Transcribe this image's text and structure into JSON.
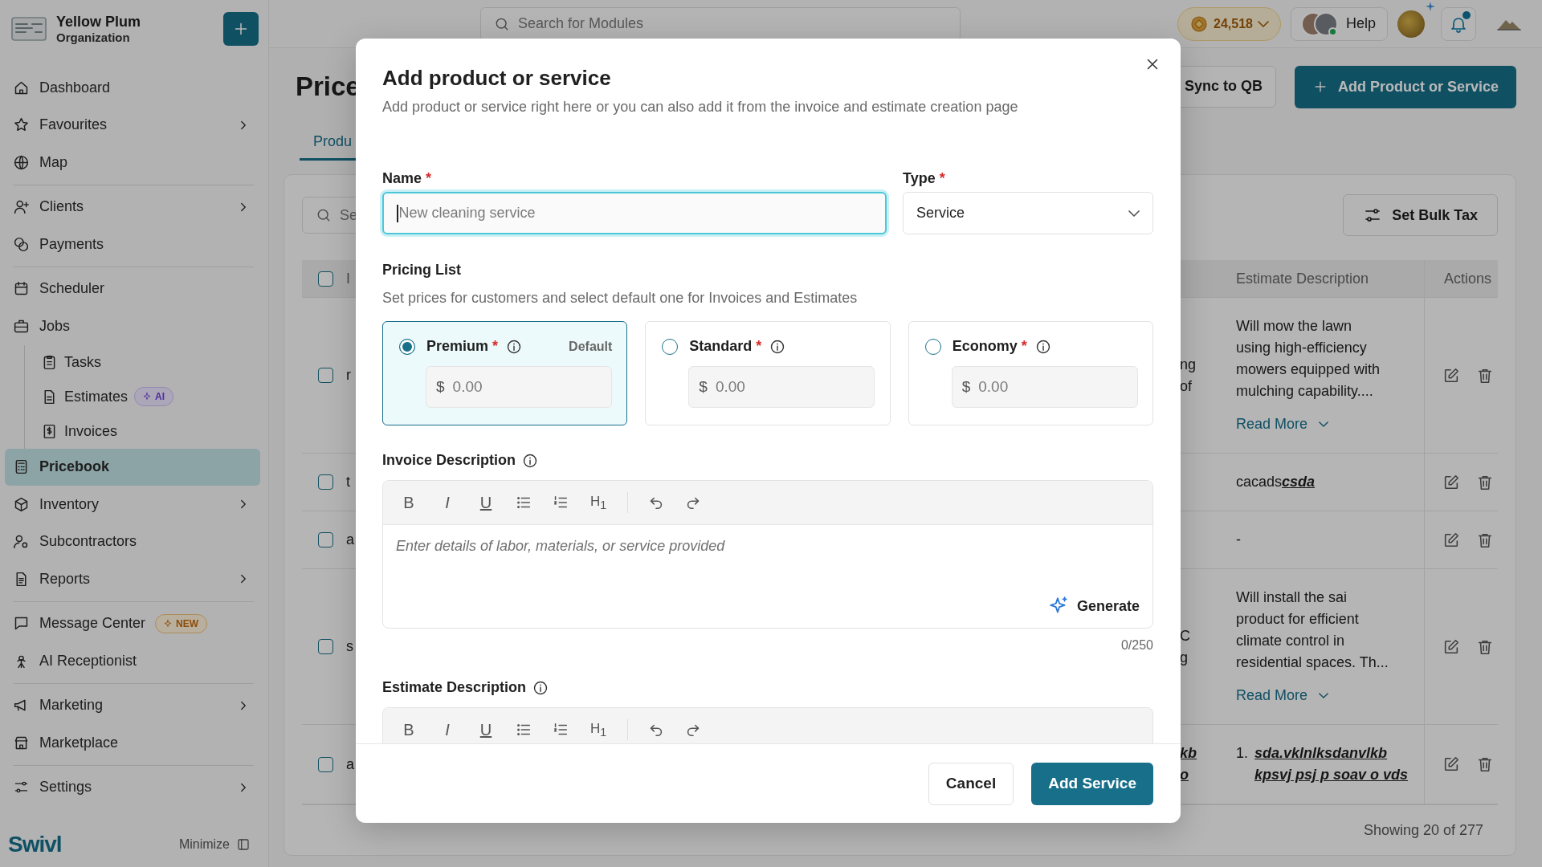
{
  "sidebar": {
    "org_name": "Yellow Plum",
    "org_subtitle": "Organization",
    "groups": [
      [
        {
          "label": "Dashboard",
          "selected": false,
          "has_submenu": false
        },
        {
          "label": "Favourites",
          "selected": false,
          "has_submenu": true
        },
        {
          "label": "Map",
          "selected": false,
          "has_submenu": false
        }
      ],
      [
        {
          "label": "Clients",
          "selected": false,
          "has_submenu": true
        },
        {
          "label": "Payments",
          "selected": false,
          "has_submenu": false
        }
      ],
      [
        {
          "label": "Scheduler",
          "selected": false,
          "has_submenu": false
        },
        {
          "label": "Jobs",
          "selected": false,
          "has_submenu": false,
          "children": [
            {
              "label": "Tasks",
              "selected": false
            },
            {
              "label": "Estimates",
              "selected": false,
              "badge": {
                "kind": "ai",
                "label": "AI"
              }
            },
            {
              "label": "Invoices",
              "selected": false
            }
          ]
        },
        {
          "label": "Pricebook",
          "selected": true,
          "has_submenu": false
        },
        {
          "label": "Inventory",
          "selected": false,
          "has_submenu": true
        },
        {
          "label": "Subcontractors",
          "selected": false,
          "has_submenu": false
        },
        {
          "label": "Reports",
          "selected": false,
          "has_submenu": true
        }
      ],
      [
        {
          "label": "Message Center",
          "selected": false,
          "has_submenu": false,
          "badge": {
            "kind": "new",
            "label": "NEW"
          }
        },
        {
          "label": "AI Receptionist",
          "selected": false,
          "has_submenu": false
        }
      ],
      [
        {
          "label": "Marketing",
          "selected": false,
          "has_submenu": true
        },
        {
          "label": "Marketplace",
          "selected": false,
          "has_submenu": false
        }
      ],
      [
        {
          "label": "Settings",
          "selected": false,
          "has_submenu": true
        }
      ]
    ],
    "logo": "Swivl",
    "minimize": "Minimize"
  },
  "top_bar": {
    "search_placeholder": "Search for Modules",
    "credits": "24,518",
    "help": "Help",
    "has_notification": true
  },
  "page": {
    "title": "Price",
    "tabs": [
      {
        "label": "Produ",
        "selected": true
      }
    ],
    "sync_button": "Sync to QB",
    "add_button": "Add Product or Service",
    "search_placeholder": "Se",
    "bulk_tax_button": "Set Bulk Tax",
    "table": {
      "columns": [
        {
          "label": "I"
        },
        {
          "label": "Estimate Description"
        },
        {
          "label": "Actions"
        }
      ],
      "header_checked": false,
      "rows": [
        {
          "checked": false,
          "column_2": "r",
          "column_3": [
            "ng",
            "of"
          ],
          "estimate_description": "Will mow the lawn using high-efficiency mowers equipped with mulching capability....",
          "read_more": "Read More"
        },
        {
          "checked": false,
          "column_2": "t",
          "column_3": [],
          "estimate_description": "cacads**csda**"
        },
        {
          "checked": false,
          "column_2": "a",
          "column_3": [],
          "estimate_description": "-"
        },
        {
          "checked": false,
          "column_2": "s",
          "column_3": [
            "C",
            "g"
          ],
          "estimate_description": "Will install the sai product for efficient climate control in residential spaces. Th...",
          "read_more": "Read More"
        },
        {
          "checked": false,
          "column_2": "a",
          "column_3": [
            "kb",
            "o"
          ],
          "list_number": "1.",
          "list_text": "sda.vklnlksdanvlkb kpsvj psj p soav o vds"
        }
      ]
    },
    "footer": "Showing 20 of 277"
  },
  "modal": {
    "title": "Add product or service",
    "subtitle": "Add product or service right here or you can also add it from the invoice and estimate creation page",
    "name": {
      "label": "Name",
      "required_mark": "*",
      "placeholder": "New cleaning service",
      "focused": true
    },
    "type": {
      "label": "Type",
      "required_mark": "*",
      "value": "Service"
    },
    "pricing": {
      "title": "Pricing List",
      "subtitle": "Set prices for customers and select default one for Invoices and Estimates",
      "tiers": [
        {
          "name": "Premium",
          "required_mark": "*",
          "selected": true,
          "default_label": "Default",
          "currency": "$",
          "placeholder": "0.00"
        },
        {
          "name": "Standard",
          "required_mark": "*",
          "selected": false,
          "currency": "$",
          "placeholder": "0.00"
        },
        {
          "name": "Economy",
          "required_mark": "*",
          "selected": false,
          "currency": "$",
          "placeholder": "0.00"
        }
      ]
    },
    "invoice_description": {
      "label": "Invoice Description",
      "placeholder": "Enter details of labor, materials, or service provided",
      "generate": "Generate",
      "counter": "0/250",
      "toolbar": [
        {
          "kind": "bold",
          "label": "B"
        },
        {
          "kind": "italic",
          "label": "I"
        },
        {
          "kind": "underline",
          "label": "U"
        },
        {
          "kind": "bullets"
        },
        {
          "kind": "numbers"
        },
        {
          "kind": "heading",
          "label": "H$_{1}$"
        },
        {
          "kind": "separator"
        },
        {
          "kind": "undo"
        },
        {
          "kind": "redo"
        }
      ]
    },
    "estimate_description": {
      "label": "Estimate Description",
      "toolbar": [
        {
          "kind": "bold",
          "label": "B"
        },
        {
          "kind": "italic",
          "label": "I"
        },
        {
          "kind": "underline",
          "label": "U"
        },
        {
          "kind": "bullets"
        },
        {
          "kind": "numbers"
        },
        {
          "kind": "heading",
          "label": "H$_{1}$"
        },
        {
          "kind": "separator"
        },
        {
          "kind": "undo"
        },
        {
          "kind": "redo"
        }
      ]
    },
    "cancel": "Cancel",
    "submit": "Add Service"
  }
}
